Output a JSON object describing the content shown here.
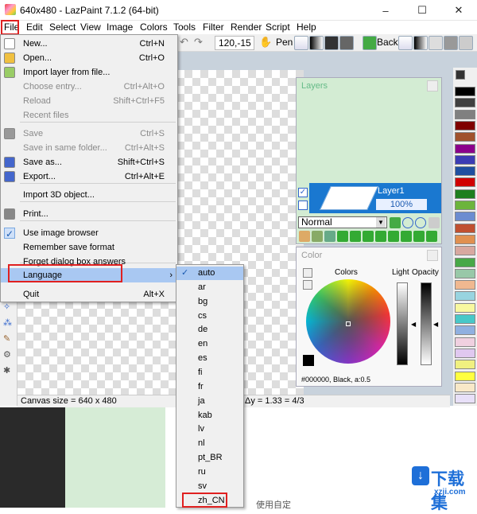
{
  "window": {
    "title": "640x480 - LazPaint 7.1.2 (64-bit)",
    "controls": [
      "–",
      "☐",
      "✕"
    ]
  },
  "menubar": [
    "File",
    "Edit",
    "Select",
    "View",
    "Image",
    "Colors",
    "Tools",
    "Filter",
    "Render",
    "Script",
    "Help"
  ],
  "toolbar": {
    "coords": "120,-15",
    "pen_label": "Pen",
    "back_label": "Back"
  },
  "file_menu": {
    "items": [
      {
        "label": "New...",
        "shortcut": "Ctrl+N",
        "enabled": true,
        "icon": "new-file-icon"
      },
      {
        "label": "Open...",
        "shortcut": "Ctrl+O",
        "enabled": true,
        "icon": "open-folder-icon"
      },
      {
        "label": "Import layer from file...",
        "shortcut": "",
        "enabled": true,
        "icon": "import-layer-icon"
      },
      {
        "label": "Choose entry...",
        "shortcut": "Ctrl+Alt+O",
        "enabled": false,
        "icon": ""
      },
      {
        "label": "Reload",
        "shortcut": "Shift+Ctrl+F5",
        "enabled": false,
        "icon": ""
      },
      {
        "label": "Recent files",
        "shortcut": "",
        "enabled": false,
        "icon": ""
      },
      {
        "label": "Save",
        "shortcut": "Ctrl+S",
        "enabled": false,
        "icon": "save-icon"
      },
      {
        "label": "Save in same folder...",
        "shortcut": "Ctrl+Alt+S",
        "enabled": false,
        "icon": ""
      },
      {
        "label": "Save as...",
        "shortcut": "Shift+Ctrl+S",
        "enabled": true,
        "icon": "save-as-icon"
      },
      {
        "label": "Export...",
        "shortcut": "Ctrl+Alt+E",
        "enabled": true,
        "icon": "export-icon"
      },
      {
        "label": "Import 3D object...",
        "shortcut": "",
        "enabled": true,
        "icon": ""
      },
      {
        "label": "Print...",
        "shortcut": "",
        "enabled": true,
        "icon": "print-icon"
      },
      {
        "label": "Use image browser",
        "shortcut": "",
        "enabled": true,
        "icon": "checkmark-icon"
      },
      {
        "label": "Remember save format",
        "shortcut": "",
        "enabled": true,
        "icon": ""
      },
      {
        "label": "Forget dialog box answers",
        "shortcut": "",
        "enabled": true,
        "icon": ""
      },
      {
        "label": "Language",
        "shortcut": "",
        "enabled": true,
        "icon": ""
      },
      {
        "label": "Quit",
        "shortcut": "Alt+X",
        "enabled": true,
        "icon": ""
      }
    ]
  },
  "language_menu": {
    "items": [
      "auto",
      "ar",
      "bg",
      "cs",
      "de",
      "en",
      "es",
      "fi",
      "fr",
      "ja",
      "kab",
      "lv",
      "nl",
      "pt_BR",
      "ru",
      "sv",
      "zh_CN"
    ],
    "selected": "auto"
  },
  "layers_panel": {
    "title": "Layers",
    "layer_name": "Layer1",
    "opacity": "100%",
    "blend_mode": "Normal"
  },
  "color_panel": {
    "title": "Color",
    "colors_label": "Colors",
    "light_label": "Light",
    "opacity_label": "Opacity",
    "current_color": "#000000, Black, a:0.5"
  },
  "status": {
    "canvas_size": "Canvas size = 640 x 480",
    "ratio": "Δy = 1.33 = 4/3"
  },
  "palette_colors": [
    "#000000",
    "#404040",
    "#808080",
    "#7f0000",
    "#a0522d",
    "#8b008b",
    "#3c3cb4",
    "#1f4fa0",
    "#d00000",
    "#1e7f1e",
    "#6cb43c",
    "#6c8cd0",
    "#c05030",
    "#e09050",
    "#d8a8a0",
    "#48a848",
    "#98c8a8",
    "#f0b890",
    "#98d4e0",
    "#f8f8a0",
    "#48c8c8",
    "#90b0e0",
    "#f0d0e0",
    "#e0c8f0",
    "#f0f080",
    "#ffff40",
    "#f8e8c8",
    "#e8e0f8"
  ],
  "bottom": {
    "caption": "使用自定"
  },
  "watermark": {
    "brand": "下载集",
    "url": "xzji.com"
  }
}
